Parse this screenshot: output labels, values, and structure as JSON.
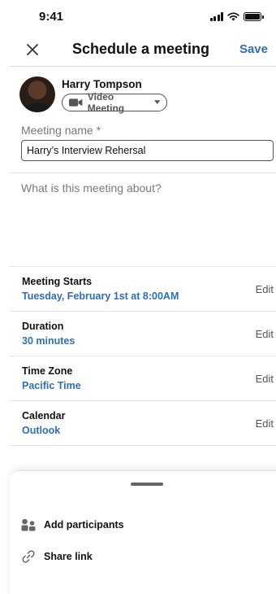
{
  "status": {
    "time": "9:41"
  },
  "nav": {
    "title": "Schedule a meeting",
    "save": "Save"
  },
  "host": {
    "name": "Harry Tompson",
    "meeting_type": "Video Meeting"
  },
  "form": {
    "name_label": "Meeting name *",
    "name_value": "Harry’s Interview Rehersal",
    "description_placeholder": "What is this meeting about?"
  },
  "details": [
    {
      "title": "Meeting Starts",
      "value": "Tuesday, February 1st at 8:00AM",
      "action": "Edit"
    },
    {
      "title": "Duration",
      "value": "30 minutes",
      "action": "Edit"
    },
    {
      "title": "Time Zone",
      "value": "Pacific Time",
      "action": "Edit"
    },
    {
      "title": "Calendar",
      "value": "Outlook",
      "action": "Edit"
    }
  ],
  "sheet": {
    "add_participants": "Add participants",
    "share_link": "Share link"
  },
  "colors": {
    "accent": "#2f6fb5",
    "text": "#111111",
    "muted": "#777777"
  },
  "icons": [
    "signal-icon",
    "wifi-icon",
    "battery-icon",
    "close-icon",
    "video-camera-icon",
    "dropdown-triangle-icon",
    "people-icon",
    "link-icon"
  ]
}
